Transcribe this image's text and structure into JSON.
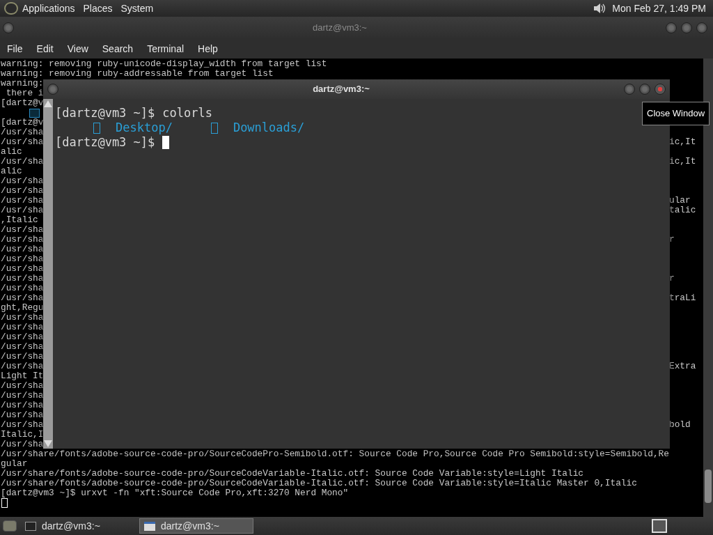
{
  "top_panel": {
    "menus": [
      "Applications",
      "Places",
      "System"
    ],
    "clock": "Mon Feb 27, 1:49 PM"
  },
  "back_window": {
    "title": "dartz@vm3:~",
    "menu": [
      "File",
      "Edit",
      "View",
      "Search",
      "Terminal",
      "Help"
    ],
    "lines": [
      {
        "kind": "text",
        "left": "warning: removing ruby-unicode-display_width from target list"
      },
      {
        "kind": "text",
        "left": "warning: removing ruby-addressable from target list"
      },
      {
        "kind": "text",
        "left": "warning:"
      },
      {
        "kind": "text",
        "left": " there i"
      },
      {
        "kind": "text",
        "left": "[dartz@v"
      },
      {
        "kind": "glyph"
      },
      {
        "kind": "text",
        "left": "[dartz@v"
      },
      {
        "kind": "text",
        "left": "/usr/sha"
      },
      {
        "kind": "text",
        "left": "/usr/sha",
        "right": "ic,It"
      },
      {
        "kind": "text",
        "left": "alic"
      },
      {
        "kind": "text",
        "left": "/usr/sha",
        "right": "ic,It"
      },
      {
        "kind": "text",
        "left": "alic"
      },
      {
        "kind": "text",
        "left": "/usr/sha"
      },
      {
        "kind": "text",
        "left": "/usr/sha"
      },
      {
        "kind": "text",
        "left": "/usr/sha",
        "right": "ular"
      },
      {
        "kind": "text",
        "left": "/usr/sha",
        "right": "talic"
      },
      {
        "kind": "text",
        "left": ",Italic"
      },
      {
        "kind": "text",
        "left": "/usr/sha"
      },
      {
        "kind": "text",
        "left": "/usr/sha",
        "right": "r"
      },
      {
        "kind": "text",
        "left": "/usr/sha"
      },
      {
        "kind": "text",
        "left": "/usr/sha"
      },
      {
        "kind": "text",
        "left": "/usr/sha"
      },
      {
        "kind": "text",
        "left": "/usr/sha",
        "right": "r"
      },
      {
        "kind": "text",
        "left": "/usr/sha"
      },
      {
        "kind": "text",
        "left": "/usr/sha",
        "right": "traLi"
      },
      {
        "kind": "text",
        "left": "ght,Regu"
      },
      {
        "kind": "text",
        "left": "/usr/sha"
      },
      {
        "kind": "text",
        "left": "/usr/sha"
      },
      {
        "kind": "text",
        "left": "/usr/sha"
      },
      {
        "kind": "text",
        "left": "/usr/sha"
      },
      {
        "kind": "text",
        "left": "/usr/sha"
      },
      {
        "kind": "text",
        "left": "/usr/sha",
        "right": "Extra"
      },
      {
        "kind": "text",
        "left": "Light It"
      },
      {
        "kind": "text",
        "left": "/usr/sha"
      },
      {
        "kind": "text",
        "left": "/usr/sha"
      },
      {
        "kind": "text",
        "left": "/usr/sha"
      },
      {
        "kind": "text",
        "left": "/usr/sha"
      },
      {
        "kind": "text",
        "left": "/usr/sha",
        "right": "bold"
      },
      {
        "kind": "text",
        "left": "Italic,I"
      },
      {
        "kind": "text",
        "left": "/usr/sha"
      },
      {
        "kind": "text",
        "left": "/usr/share/fonts/adobe-source-code-pro/SourceCodePro-Semibold.otf: Source Code Pro,Source Code Pro Semibold:style=Semibold,Re"
      },
      {
        "kind": "text",
        "left": "gular"
      },
      {
        "kind": "text",
        "left": "/usr/share/fonts/adobe-source-code-pro/SourceCodeVariable-Italic.otf: Source Code Variable:style=Light Italic"
      },
      {
        "kind": "text",
        "left": "/usr/share/fonts/adobe-source-code-pro/SourceCodeVariable-Italic.otf: Source Code Variable:style=Italic Master 0,Italic"
      },
      {
        "kind": "text",
        "left": "[dartz@vm3 ~]$ urxvt -fn \"xft:Source Code Pro,xft:3270 Nerd Mono\""
      },
      {
        "kind": "cursor"
      }
    ]
  },
  "front_window": {
    "title": "dartz@vm3:~",
    "lines": [
      {
        "kind": "command",
        "prompt": "[dartz@vm3 ~]$",
        "command": "colorls"
      },
      {
        "kind": "listing",
        "entries": [
          "Desktop/",
          "Downloads/"
        ]
      },
      {
        "kind": "prompt",
        "prompt": "[dartz@vm3 ~]$"
      }
    ]
  },
  "tooltip": "Close Window",
  "taskbar": {
    "tasks": [
      {
        "label": "dartz@vm3:~",
        "selected": false
      },
      {
        "label": "dartz@vm3:~",
        "selected": true
      }
    ]
  }
}
